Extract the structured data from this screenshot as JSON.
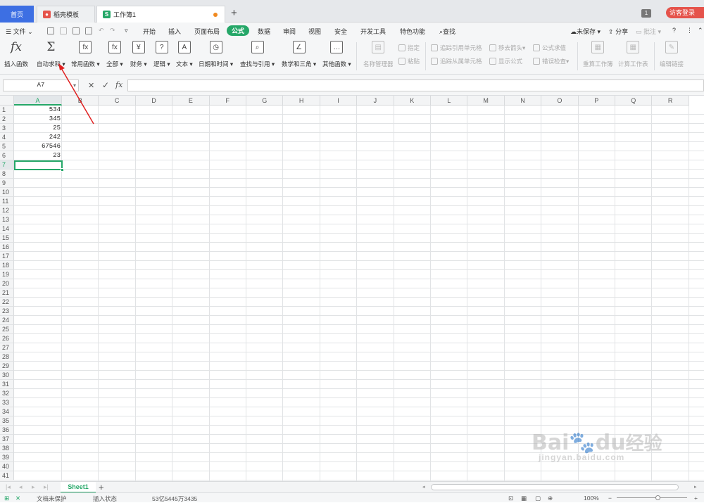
{
  "tabs": {
    "home": "首页",
    "template": "稻壳模板",
    "workbook": "工作簿1",
    "new_tab": "+",
    "window_count": "1",
    "login": "访客登录"
  },
  "menubar": {
    "file": "文件",
    "items": [
      "开始",
      "插入",
      "页面布局",
      "公式",
      "数据",
      "审阅",
      "视图",
      "安全",
      "开发工具",
      "特色功能"
    ],
    "active": "公式",
    "search": "查找",
    "unsaved": "未保存",
    "share": "分享",
    "comment": "批注"
  },
  "ribbon": {
    "insert_func": "插入函数",
    "autosum": "自动求和",
    "common": "常用函数",
    "all": "全部",
    "finance": "财务",
    "logic": "逻辑",
    "text": "文本",
    "datetime": "日期和时间",
    "lookup": "查找与引用",
    "math": "数学和三角",
    "other": "其他函数",
    "name_mgr": "名称管理器",
    "specify": "指定",
    "paste": "粘贴",
    "trace_prec": "追踪引用单元格",
    "trace_dep": "追踪从属单元格",
    "remove_arrows": "移去箭头",
    "show_formula": "显示公式",
    "eval_formula": "公式求值",
    "error_check": "错误检查",
    "recalc_book": "重算工作簿",
    "calc_sheet": "计算工作表",
    "edit_links": "编辑链接"
  },
  "formula_bar": {
    "name_box": "A7",
    "cancel": "✕",
    "confirm": "✓",
    "fx": "fx",
    "value": ""
  },
  "columns": [
    "A",
    "B",
    "C",
    "D",
    "E",
    "F",
    "G",
    "H",
    "I",
    "J",
    "K",
    "L",
    "M",
    "N",
    "O",
    "P",
    "Q",
    "R"
  ],
  "rows": 41,
  "cells": {
    "A1": "534",
    "A2": "345",
    "A3": "25",
    "A4": "242",
    "A5": "67546",
    "A6": "23"
  },
  "selected_cell": "A7",
  "sheet": {
    "name": "Sheet1",
    "add": "+"
  },
  "status": {
    "protect": "文档未保护",
    "mode": "插入状态",
    "sum": "53亿5445万3435",
    "zoom": "100%"
  },
  "watermark": {
    "brand": "Bai",
    "brand2": "du",
    "brand_cn": "经验",
    "url": "jingyan.baidu.com"
  },
  "colors": {
    "accent_green": "#25a768",
    "tab_blue": "#3d6fe3",
    "login_red": "#e5534b",
    "arrow_red": "#e02020"
  }
}
